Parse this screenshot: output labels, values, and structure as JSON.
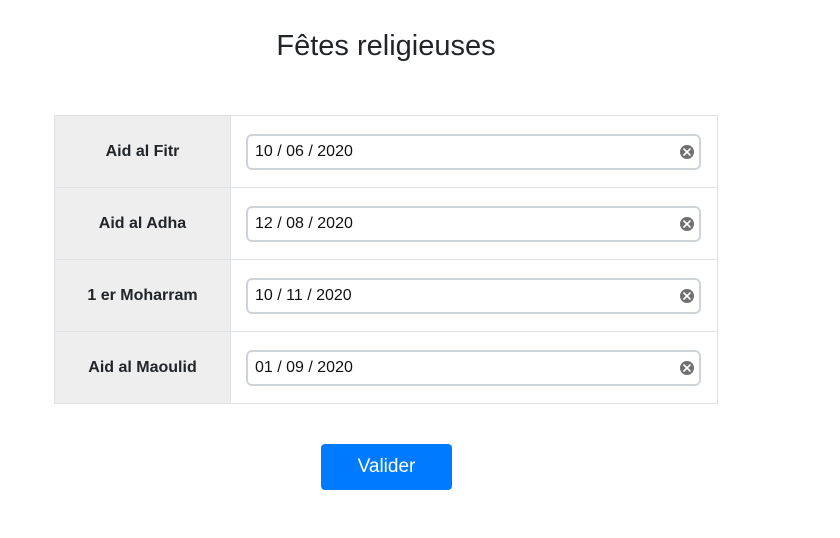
{
  "page": {
    "title": "Fêtes religieuses"
  },
  "holidays": [
    {
      "label": "Aid al Fitr",
      "date": "10 / 06 / 2020"
    },
    {
      "label": "Aid al Adha",
      "date": "12 / 08 / 2020"
    },
    {
      "label": "1 er Moharram",
      "date": "10 / 11 / 2020"
    },
    {
      "label": "Aid al Maoulid",
      "date": "01 / 09 / 2020"
    }
  ],
  "form": {
    "submit_label": "Valider"
  },
  "icons": {
    "clear": "clear-icon"
  },
  "colors": {
    "primary": "#007bff",
    "label_background": "#eeeeee",
    "border": "#dee2e6"
  }
}
